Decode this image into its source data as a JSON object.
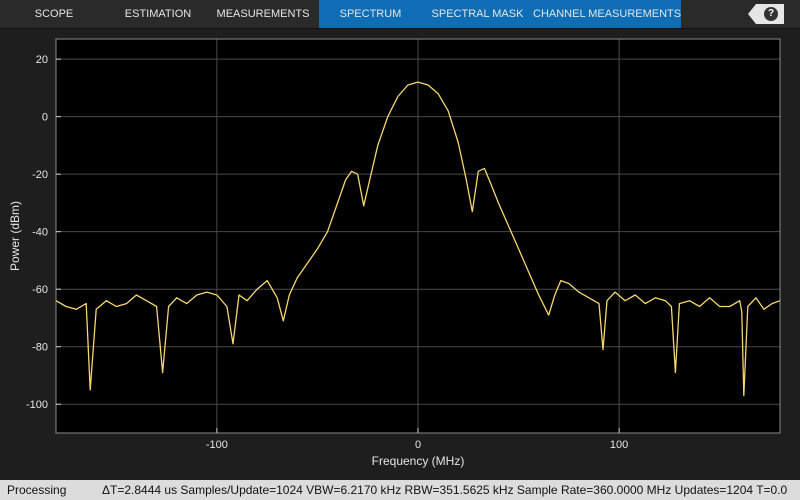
{
  "toolstrip": {
    "tabs": [
      {
        "label": "SCOPE"
      },
      {
        "label": "ESTIMATION"
      },
      {
        "label": "MEASUREMENTS"
      },
      {
        "label": "SPECTRUM"
      },
      {
        "label": "SPECTRAL MASK"
      },
      {
        "label": "CHANNEL MEASUREMENTS"
      }
    ],
    "help_icon": "help-icon",
    "help_glyph": "?",
    "active_group_color": "#0e6db4"
  },
  "status": {
    "left": "Processing",
    "right": "ΔT=2.8444 us  Samples/Update=1024  VBW=6.2170 kHz  RBW=351.5625 kHz  Sample Rate=360.0000 MHz  Updates=1204  T=0.0"
  },
  "chart_data": {
    "type": "line",
    "xlabel": "Frequency (MHz)",
    "ylabel": "Power (dBm)",
    "xlim": [
      -180,
      180
    ],
    "ylim": [
      -110,
      27
    ],
    "xticks": [
      -100,
      0,
      100
    ],
    "yticks": [
      20,
      0,
      -20,
      -40,
      -60,
      -80,
      -100
    ],
    "grid": true,
    "line_color": "#f5d76e",
    "series": [
      {
        "x": [
          -180,
          -175,
          -170,
          -165,
          -163,
          -160,
          -155,
          -150,
          -145,
          -140,
          -135,
          -130,
          -127,
          -124,
          -120,
          -115,
          -110,
          -105,
          -100,
          -95,
          -92,
          -89,
          -85,
          -80,
          -75,
          -70,
          -67,
          -64,
          -60,
          -55,
          -50,
          -45,
          -40,
          -36,
          -33,
          -30,
          -27,
          -24,
          -20,
          -15,
          -10,
          -5,
          0,
          5,
          10,
          15,
          20,
          24,
          27,
          30,
          33,
          36,
          40,
          45,
          50,
          55,
          60,
          65,
          68,
          71,
          75,
          80,
          85,
          90,
          92,
          94,
          98,
          103,
          108,
          113,
          118,
          123,
          126,
          128,
          130,
          135,
          140,
          145,
          150,
          155,
          160,
          161,
          162,
          164,
          168,
          172,
          176,
          180
        ],
        "y": [
          -64,
          -66,
          -67,
          -65,
          -95,
          -67,
          -64,
          -66,
          -65,
          -62,
          -64,
          -66,
          -89,
          -66,
          -63,
          -65,
          -62,
          -61,
          -62,
          -66,
          -79,
          -62,
          -64,
          -60,
          -57,
          -63,
          -71,
          -62,
          -56,
          -51,
          -46,
          -40,
          -30,
          -22,
          -19,
          -20,
          -31,
          -22,
          -10,
          0,
          7,
          11,
          12,
          11,
          8,
          2,
          -9,
          -22,
          -33,
          -19,
          -18,
          -23,
          -30,
          -38,
          -46,
          -54,
          -62,
          -69,
          -62,
          -57,
          -58,
          -61,
          -63,
          -65,
          -81,
          -64,
          -61,
          -64,
          -62,
          -65,
          -63,
          -64,
          -66,
          -89,
          -65,
          -64,
          -66,
          -63,
          -66,
          -66,
          -64,
          -68,
          -97,
          -66,
          -63,
          -67,
          -65,
          -64
        ]
      }
    ]
  }
}
